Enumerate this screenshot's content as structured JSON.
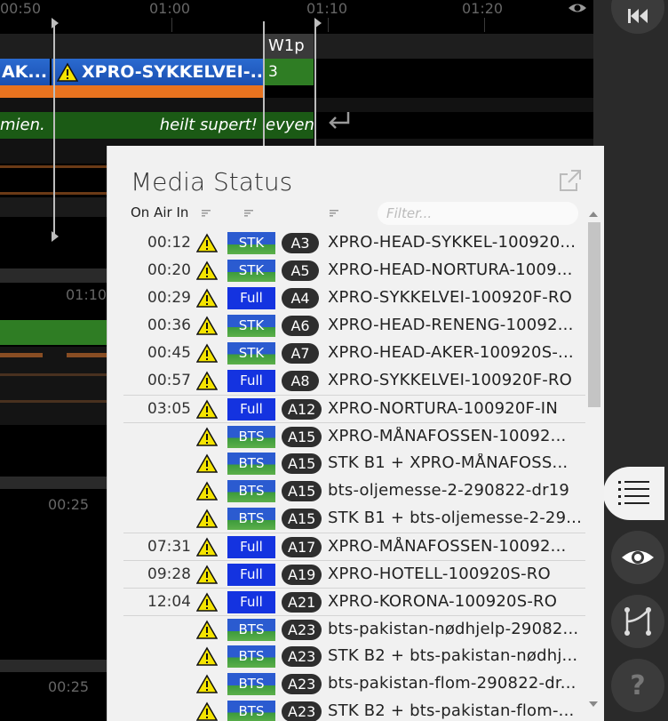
{
  "timeline": {
    "ruler_labels": [
      "00:50",
      "01:00",
      "01:10",
      "01:20"
    ],
    "ruler2_label": "01:10",
    "ruler3_label": "00:25",
    "ruler4_label": "00:25",
    "segment_left": "AK...",
    "segment_main": "XPRO-SYKKELVEI-...",
    "segment_w1p_title": "W1p",
    "segment_w1p_count": "3",
    "sub_left": "mien.",
    "sub_mid": "heilt supert!",
    "sub_right": "evyen"
  },
  "panel": {
    "title": "Media Status",
    "column_header": "On Air In",
    "filter_placeholder": "Filter..."
  },
  "colors": {
    "warning": "#f5e400",
    "full": "#1433e0",
    "badge": "#2e2e2e"
  },
  "rows": [
    {
      "time": "00:12",
      "src": "STK",
      "badge": "A3",
      "name": "XPRO-HEAD-SYKKEL-100920...",
      "sep": false
    },
    {
      "time": "00:20",
      "src": "STK",
      "badge": "A5",
      "name": "XPRO-HEAD-NORTURA-1009...",
      "sep": false
    },
    {
      "time": "00:29",
      "src": "Full",
      "badge": "A4",
      "name": "XPRO-SYKKELVEI-100920F-RO",
      "sep": false
    },
    {
      "time": "00:36",
      "src": "STK",
      "badge": "A6",
      "name": "XPRO-HEAD-RENENG-10092...",
      "sep": false
    },
    {
      "time": "00:45",
      "src": "STK",
      "badge": "A7",
      "name": "XPRO-HEAD-AKER-100920S-...",
      "sep": false
    },
    {
      "time": "00:57",
      "src": "Full",
      "badge": "A8",
      "name": "XPRO-SYKKELVEI-100920F-RO",
      "sep": false
    },
    {
      "time": "03:05",
      "src": "Full",
      "badge": "A12",
      "name": "XPRO-NORTURA-100920F-IN",
      "sep": true
    },
    {
      "time": "",
      "src": "BTS",
      "badge": "A15",
      "name": "XPRO-MÅNAFOSSEN-10092...",
      "sep": true
    },
    {
      "time": "",
      "src": "BTS",
      "badge": "A15",
      "name": "STK B1 + XPRO-MÅNAFOSS...",
      "sep": false
    },
    {
      "time": "",
      "src": "BTS",
      "badge": "A15",
      "name": "bts-oljemesse-2-290822-dr19",
      "sep": false
    },
    {
      "time": "",
      "src": "BTS",
      "badge": "A15",
      "name": "STK B1 + bts-oljemesse-2-29...",
      "sep": false
    },
    {
      "time": "07:31",
      "src": "Full",
      "badge": "A17",
      "name": "XPRO-MÅNAFOSSEN-10092...",
      "sep": true
    },
    {
      "time": "09:28",
      "src": "Full",
      "badge": "A19",
      "name": "XPRO-HOTELL-100920S-RO",
      "sep": true
    },
    {
      "time": "12:04",
      "src": "Full",
      "badge": "A21",
      "name": "XPRO-KORONA-100920S-RO",
      "sep": true
    },
    {
      "time": "",
      "src": "BTS",
      "badge": "A23",
      "name": "bts-pakistan-nødhjelp-29082...",
      "sep": true
    },
    {
      "time": "",
      "src": "BTS",
      "badge": "A23",
      "name": "STK B2 + bts-pakistan-nødhj...",
      "sep": false
    },
    {
      "time": "",
      "src": "BTS",
      "badge": "A23",
      "name": "bts-pakistan-flom-290822-dr...",
      "sep": false
    },
    {
      "time": "",
      "src": "BTS",
      "badge": "A23",
      "name": "STK B2 + bts-pakistan-flom-...",
      "sep": false
    }
  ],
  "sidebar": {
    "help_label": "?",
    "icons": [
      "rewind-icon",
      "list-icon",
      "eye-icon",
      "switch-icon",
      "help-icon"
    ]
  }
}
